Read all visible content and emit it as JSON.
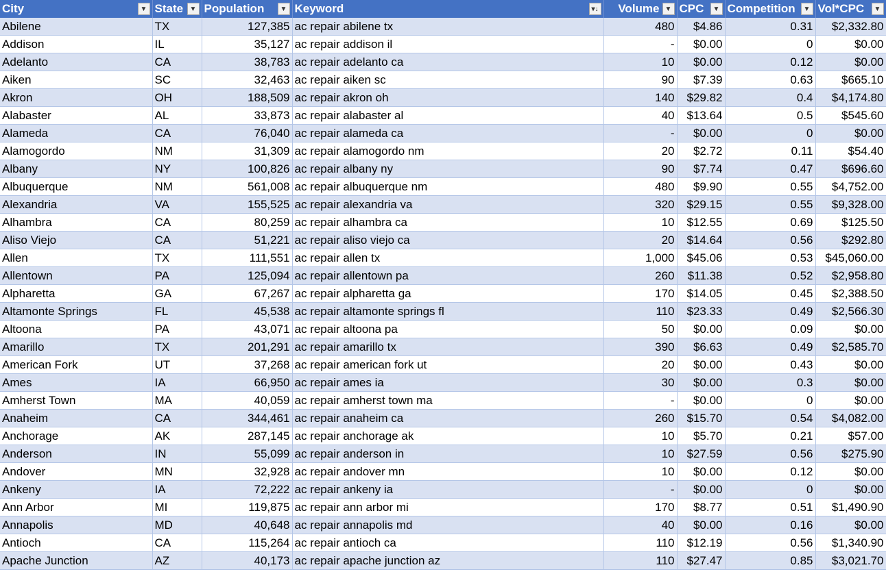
{
  "headers": {
    "city": "City",
    "state": "State",
    "population": "Population",
    "keyword": "Keyword",
    "volume": "Volume",
    "cpc": "CPC",
    "competition": "Competition",
    "vol_cpc": "Vol*CPC"
  },
  "sorted_column": "keyword",
  "rows": [
    {
      "city": "Abilene",
      "state": "TX",
      "population": "127,385",
      "keyword": "ac repair abilene tx",
      "volume": "480",
      "cpc": "$4.86",
      "competition": "0.31",
      "vol_cpc": "$2,332.80"
    },
    {
      "city": "Addison",
      "state": "IL",
      "population": "35,127",
      "keyword": "ac repair addison il",
      "volume": "-",
      "cpc": "$0.00",
      "competition": "0",
      "vol_cpc": "$0.00"
    },
    {
      "city": "Adelanto",
      "state": "CA",
      "population": "38,783",
      "keyword": "ac repair adelanto ca",
      "volume": "10",
      "cpc": "$0.00",
      "competition": "0.12",
      "vol_cpc": "$0.00"
    },
    {
      "city": "Aiken",
      "state": "SC",
      "population": "32,463",
      "keyword": "ac repair aiken sc",
      "volume": "90",
      "cpc": "$7.39",
      "competition": "0.63",
      "vol_cpc": "$665.10"
    },
    {
      "city": "Akron",
      "state": "OH",
      "population": "188,509",
      "keyword": "ac repair akron oh",
      "volume": "140",
      "cpc": "$29.82",
      "competition": "0.4",
      "vol_cpc": "$4,174.80"
    },
    {
      "city": "Alabaster",
      "state": "AL",
      "population": "33,873",
      "keyword": "ac repair alabaster al",
      "volume": "40",
      "cpc": "$13.64",
      "competition": "0.5",
      "vol_cpc": "$545.60"
    },
    {
      "city": "Alameda",
      "state": "CA",
      "population": "76,040",
      "keyword": "ac repair alameda ca",
      "volume": "-",
      "cpc": "$0.00",
      "competition": "0",
      "vol_cpc": "$0.00"
    },
    {
      "city": "Alamogordo",
      "state": "NM",
      "population": "31,309",
      "keyword": "ac repair alamogordo nm",
      "volume": "20",
      "cpc": "$2.72",
      "competition": "0.11",
      "vol_cpc": "$54.40"
    },
    {
      "city": "Albany",
      "state": "NY",
      "population": "100,826",
      "keyword": "ac repair albany ny",
      "volume": "90",
      "cpc": "$7.74",
      "competition": "0.47",
      "vol_cpc": "$696.60"
    },
    {
      "city": "Albuquerque",
      "state": "NM",
      "population": "561,008",
      "keyword": "ac repair albuquerque nm",
      "volume": "480",
      "cpc": "$9.90",
      "competition": "0.55",
      "vol_cpc": "$4,752.00"
    },
    {
      "city": "Alexandria",
      "state": "VA",
      "population": "155,525",
      "keyword": "ac repair alexandria va",
      "volume": "320",
      "cpc": "$29.15",
      "competition": "0.55",
      "vol_cpc": "$9,328.00"
    },
    {
      "city": "Alhambra",
      "state": "CA",
      "population": "80,259",
      "keyword": "ac repair alhambra ca",
      "volume": "10",
      "cpc": "$12.55",
      "competition": "0.69",
      "vol_cpc": "$125.50"
    },
    {
      "city": "Aliso Viejo",
      "state": "CA",
      "population": "51,221",
      "keyword": "ac repair aliso viejo ca",
      "volume": "20",
      "cpc": "$14.64",
      "competition": "0.56",
      "vol_cpc": "$292.80"
    },
    {
      "city": "Allen",
      "state": "TX",
      "population": "111,551",
      "keyword": "ac repair allen tx",
      "volume": "1,000",
      "cpc": "$45.06",
      "competition": "0.53",
      "vol_cpc": "$45,060.00"
    },
    {
      "city": "Allentown",
      "state": "PA",
      "population": "125,094",
      "keyword": "ac repair allentown pa",
      "volume": "260",
      "cpc": "$11.38",
      "competition": "0.52",
      "vol_cpc": "$2,958.80"
    },
    {
      "city": "Alpharetta",
      "state": "GA",
      "population": "67,267",
      "keyword": "ac repair alpharetta ga",
      "volume": "170",
      "cpc": "$14.05",
      "competition": "0.45",
      "vol_cpc": "$2,388.50"
    },
    {
      "city": "Altamonte Springs",
      "state": "FL",
      "population": "45,538",
      "keyword": "ac repair altamonte springs fl",
      "volume": "110",
      "cpc": "$23.33",
      "competition": "0.49",
      "vol_cpc": "$2,566.30"
    },
    {
      "city": "Altoona",
      "state": "PA",
      "population": "43,071",
      "keyword": "ac repair altoona pa",
      "volume": "50",
      "cpc": "$0.00",
      "competition": "0.09",
      "vol_cpc": "$0.00"
    },
    {
      "city": "Amarillo",
      "state": "TX",
      "population": "201,291",
      "keyword": "ac repair amarillo tx",
      "volume": "390",
      "cpc": "$6.63",
      "competition": "0.49",
      "vol_cpc": "$2,585.70"
    },
    {
      "city": "American Fork",
      "state": "UT",
      "population": "37,268",
      "keyword": "ac repair american fork ut",
      "volume": "20",
      "cpc": "$0.00",
      "competition": "0.43",
      "vol_cpc": "$0.00"
    },
    {
      "city": "Ames",
      "state": "IA",
      "population": "66,950",
      "keyword": "ac repair ames ia",
      "volume": "30",
      "cpc": "$0.00",
      "competition": "0.3",
      "vol_cpc": "$0.00"
    },
    {
      "city": "Amherst Town",
      "state": "MA",
      "population": "40,059",
      "keyword": "ac repair amherst town ma",
      "volume": "-",
      "cpc": "$0.00",
      "competition": "0",
      "vol_cpc": "$0.00"
    },
    {
      "city": "Anaheim",
      "state": "CA",
      "population": "344,461",
      "keyword": "ac repair anaheim ca",
      "volume": "260",
      "cpc": "$15.70",
      "competition": "0.54",
      "vol_cpc": "$4,082.00"
    },
    {
      "city": "Anchorage",
      "state": "AK",
      "population": "287,145",
      "keyword": "ac repair anchorage ak",
      "volume": "10",
      "cpc": "$5.70",
      "competition": "0.21",
      "vol_cpc": "$57.00"
    },
    {
      "city": "Anderson",
      "state": "IN",
      "population": "55,099",
      "keyword": "ac repair anderson in",
      "volume": "10",
      "cpc": "$27.59",
      "competition": "0.56",
      "vol_cpc": "$275.90"
    },
    {
      "city": "Andover",
      "state": "MN",
      "population": "32,928",
      "keyword": "ac repair andover mn",
      "volume": "10",
      "cpc": "$0.00",
      "competition": "0.12",
      "vol_cpc": "$0.00"
    },
    {
      "city": "Ankeny",
      "state": "IA",
      "population": "72,222",
      "keyword": "ac repair ankeny ia",
      "volume": "-",
      "cpc": "$0.00",
      "competition": "0",
      "vol_cpc": "$0.00"
    },
    {
      "city": "Ann Arbor",
      "state": "MI",
      "population": "119,875",
      "keyword": "ac repair ann arbor mi",
      "volume": "170",
      "cpc": "$8.77",
      "competition": "0.51",
      "vol_cpc": "$1,490.90"
    },
    {
      "city": "Annapolis",
      "state": "MD",
      "population": "40,648",
      "keyword": "ac repair annapolis md",
      "volume": "40",
      "cpc": "$0.00",
      "competition": "0.16",
      "vol_cpc": "$0.00"
    },
    {
      "city": "Antioch",
      "state": "CA",
      "population": "115,264",
      "keyword": "ac repair antioch ca",
      "volume": "110",
      "cpc": "$12.19",
      "competition": "0.56",
      "vol_cpc": "$1,340.90"
    },
    {
      "city": "Apache Junction",
      "state": "AZ",
      "population": "40,173",
      "keyword": "ac repair apache junction az",
      "volume": "110",
      "cpc": "$27.47",
      "competition": "0.85",
      "vol_cpc": "$3,021.70"
    }
  ]
}
